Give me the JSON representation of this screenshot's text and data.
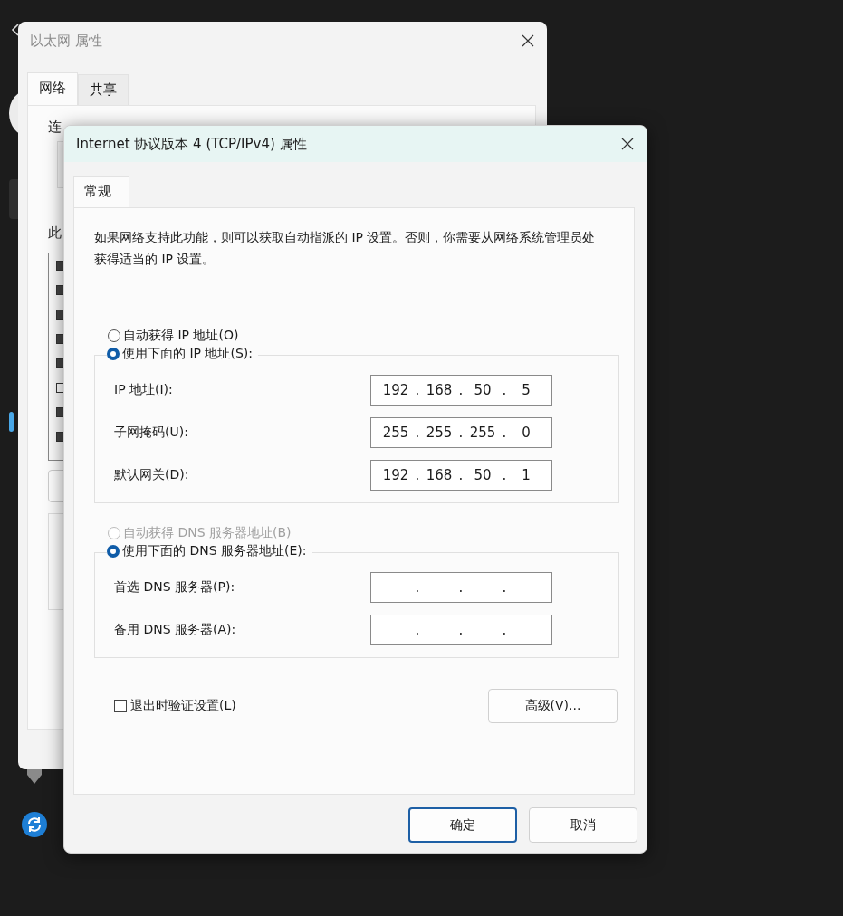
{
  "background_window": {
    "title": "以太网 属性",
    "active": false,
    "tabs": [
      {
        "label": "网络",
        "selected": true
      },
      {
        "label": "共享",
        "selected": false
      }
    ],
    "labels": [
      "连",
      "此"
    ],
    "checkboxes": [
      {
        "checked": true
      },
      {
        "checked": true
      },
      {
        "checked": true
      },
      {
        "checked": true
      },
      {
        "checked": true
      },
      {
        "checked": false
      },
      {
        "checked": true
      },
      {
        "checked": true
      }
    ]
  },
  "dialog": {
    "title": "Internet 协议版本 4 (TCP/IPv4) 属性",
    "active": true,
    "tabs": [
      {
        "label": "常规",
        "selected": true
      }
    ],
    "description": "如果网络支持此功能，则可以获取自动指派的 IP 设置。否则，你需要从网络系统管理员处获得适当的 IP 设置。",
    "ip_options": [
      {
        "label": "自动获得 IP 地址(O)",
        "selected": false,
        "disabled": false
      },
      {
        "label": "使用下面的 IP 地址(S):",
        "selected": true,
        "disabled": false
      }
    ],
    "ip_fields": [
      {
        "label": "IP 地址(I):",
        "octets": [
          "192",
          "168",
          "50",
          "5"
        ]
      },
      {
        "label": "子网掩码(U):",
        "octets": [
          "255",
          "255",
          "255",
          "0"
        ]
      },
      {
        "label": "默认网关(D):",
        "octets": [
          "192",
          "168",
          "50",
          "1"
        ]
      }
    ],
    "dns_options": [
      {
        "label": "自动获得 DNS 服务器地址(B)",
        "selected": false,
        "disabled": true
      },
      {
        "label": "使用下面的 DNS 服务器地址(E):",
        "selected": true,
        "disabled": false
      }
    ],
    "dns_fields": [
      {
        "label": "首选 DNS 服务器(P):"
      },
      {
        "label": "备用 DNS 服务器(A):"
      }
    ],
    "separator": ".",
    "validate_on_exit": {
      "label": "退出时验证设置(L)",
      "checked": false
    },
    "advanced_button": "高级(V)...",
    "buttons": [
      {
        "label": "确定",
        "default": true
      },
      {
        "label": "取消",
        "default": false
      }
    ]
  }
}
